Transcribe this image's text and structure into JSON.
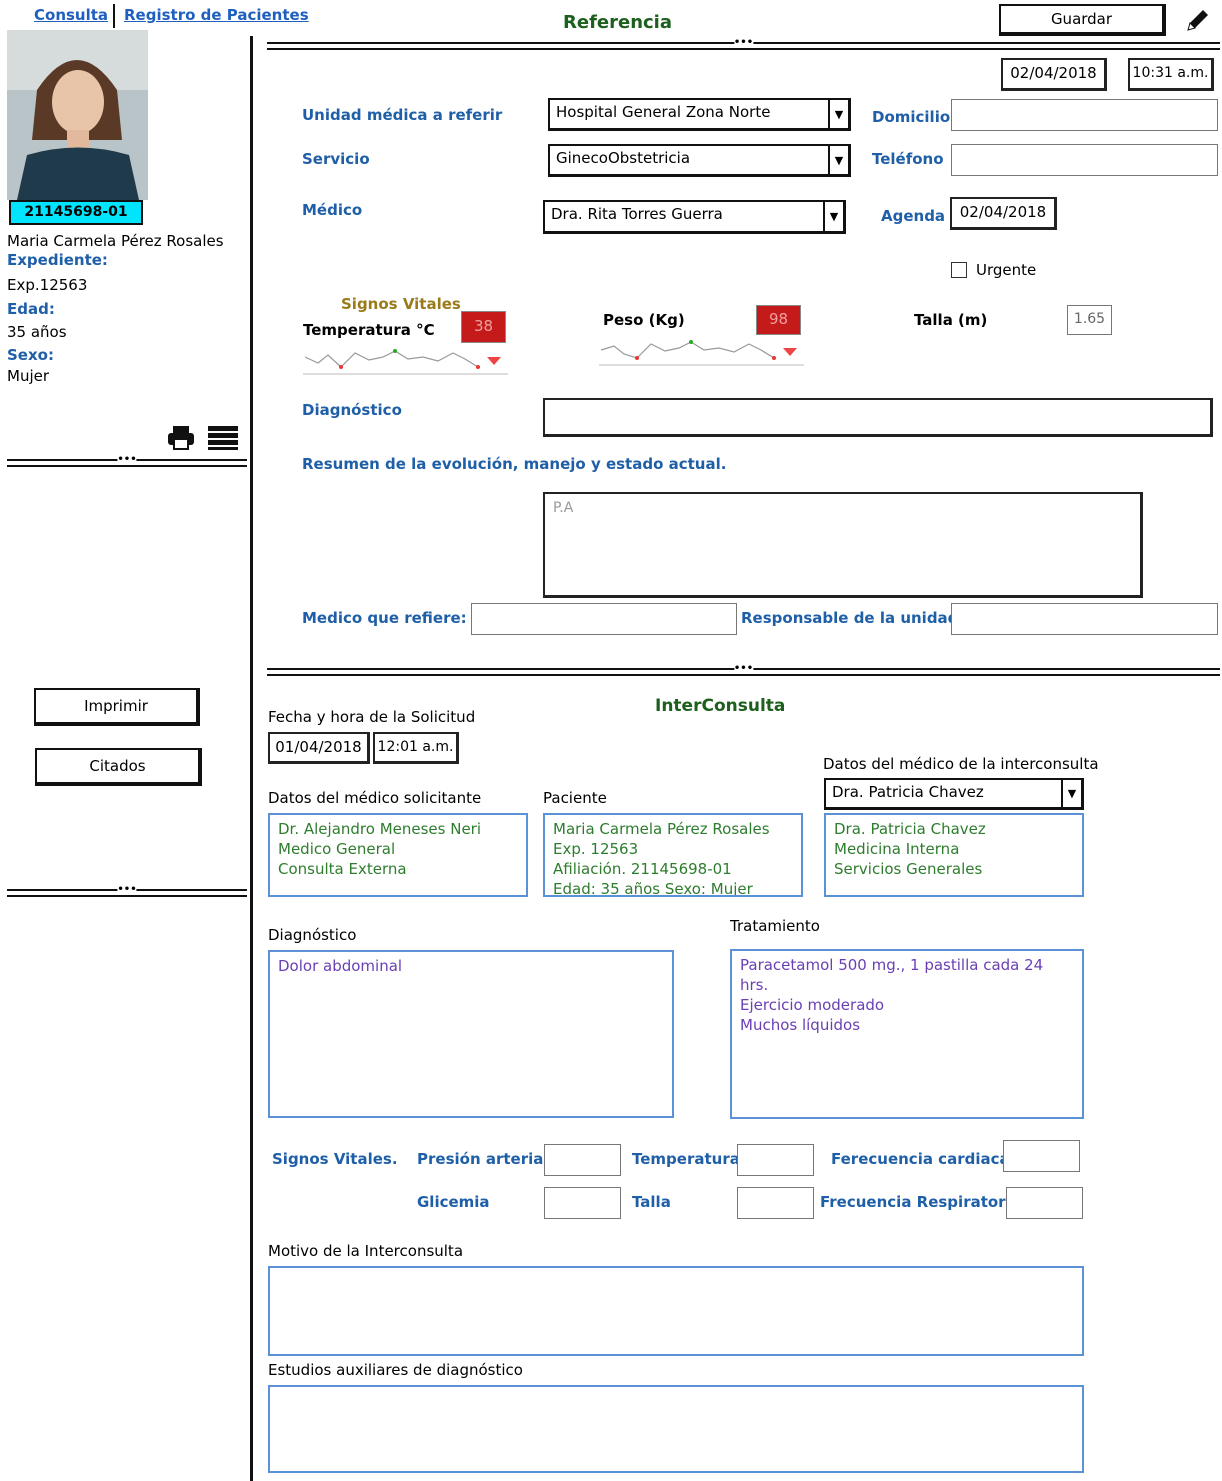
{
  "nav": {
    "consulta": "Consulta",
    "registro": "Registro de Pacientes"
  },
  "patient": {
    "id": "21145698-01",
    "name": "Maria Carmela Pérez Rosales",
    "expediente_label": "Expediente:",
    "expediente": "Exp.12563",
    "edad_label": "Edad:",
    "edad": "35 años",
    "sexo_label": "Sexo:",
    "sexo": "Mujer"
  },
  "left_buttons": {
    "imprimir": "Imprimir",
    "citados": "Citados"
  },
  "referencia": {
    "title": "Referencia",
    "save": "Guardar",
    "date": "02/04/2018",
    "time": "10:31 a.m.",
    "unidad_label": "Unidad médica  a referir",
    "unidad_value": "Hospital General Zona Norte",
    "servicio_label": "Servicio",
    "servicio_value": "GinecoObstetricia",
    "medico_label": "Médico",
    "medico_value": "Dra. Rita Torres Guerra",
    "domicilio_label": "Domicilio",
    "telefono_label": "Teléfono",
    "agenda_label": "Agenda",
    "agenda_value": "02/04/2018",
    "urgente_label": "Urgente",
    "signos_title": "Signos Vitales",
    "temp_label": "Temperatura  °C",
    "temp_value": "38",
    "peso_label": "Peso (Kg)",
    "peso_value": "98",
    "talla_label": "Talla (m)",
    "talla_value": "1.65",
    "diagnostico_label": "Diagnóstico",
    "resumen_label": "Resumen de la evolución, manejo y estado actual.",
    "resumen_placeholder": "P.A",
    "medico_refiere_label": "Medico que refiere:",
    "responsable_label": "Responsable de la unidad:"
  },
  "interconsulta": {
    "title": "InterConsulta",
    "fecha_label": "Fecha y hora de la Solicitud",
    "fecha": "01/04/2018",
    "hora": "12:01 a.m.",
    "medico_inter_label": "Datos del  médico de la interconsulta",
    "medico_inter_select": "Dra. Patricia Chavez",
    "solicitante_label": "Datos del  médico solicitante",
    "solicitante_lines": [
      "Dr. Alejandro Meneses Neri",
      "Medico General",
      "Consulta Externa"
    ],
    "paciente_label": "Paciente",
    "paciente_lines": [
      "Maria Carmela Pérez Rosales",
      "Exp. 12563",
      "Afiliación. 21145698-01",
      "Edad: 35 años Sexo: Mujer"
    ],
    "inter_lines": [
      "Dra. Patricia Chavez",
      "Medicina Interna",
      "Servicios Generales"
    ],
    "diagnostico_label": "Diagnóstico",
    "diagnostico_value": "Dolor abdominal",
    "tratamiento_label": "Tratamiento",
    "tratamiento_lines": [
      "Paracetamol 500 mg., 1 pastilla   cada 24 hrs.",
      "Ejercicio moderado",
      "Muchos líquidos"
    ],
    "signos_label": "Signos Vitales.",
    "presion_label": "Presión arterial:",
    "temperatura_label": "Temperatura:",
    "frec_cardiaca_label": "Ferecuencia cardiaca:",
    "glicemia_label": "Glicemia",
    "talla_label": "Talla",
    "frec_resp_label": "Frecuencia Respiratoria",
    "motivo_label": "Motivo de la Interconsulta",
    "estudios_label": "Estudios auxiliares de diagnóstico"
  },
  "icons": [
    "pencil-icon",
    "printer-icon",
    "list-icon",
    "photo-placeholder",
    "sparkline"
  ],
  "colors": {
    "link": "#1f5fbf",
    "label_blue": "#1f5fa8",
    "section_green": "#1d5f1d",
    "cyan_badge": "#00e5ff",
    "alert_red": "#c41a1a",
    "signos_gold": "#9a7b1a"
  }
}
